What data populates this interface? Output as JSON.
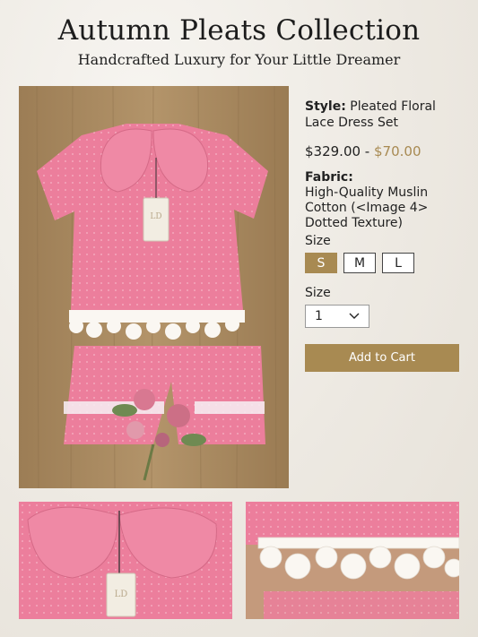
{
  "header": {
    "title": "Autumn Pleats Collection",
    "subtitle": "Handcrafted Luxury for Your Little Dreamer"
  },
  "product": {
    "style_label": "Style:",
    "style_value": "Pleated Floral Lace Dress Set",
    "price_original": "$329.00 -",
    "price_sale": "$70.00",
    "fabric_label": "Fabric:",
    "fabric_value": "High-Quality Muslin Cotton (<Image 4> Dotted Texture)",
    "size_label": "Size",
    "sizes": [
      "S",
      "M",
      "L"
    ],
    "selected_size": "S",
    "quantity_label": "Size",
    "quantity_value": "1",
    "add_to_cart": "Add to Cart"
  },
  "colors": {
    "accent": "#a88a52",
    "dress_pink": "#ec7e9c",
    "wood": "#a98a62"
  },
  "tag_monogram": "LD"
}
